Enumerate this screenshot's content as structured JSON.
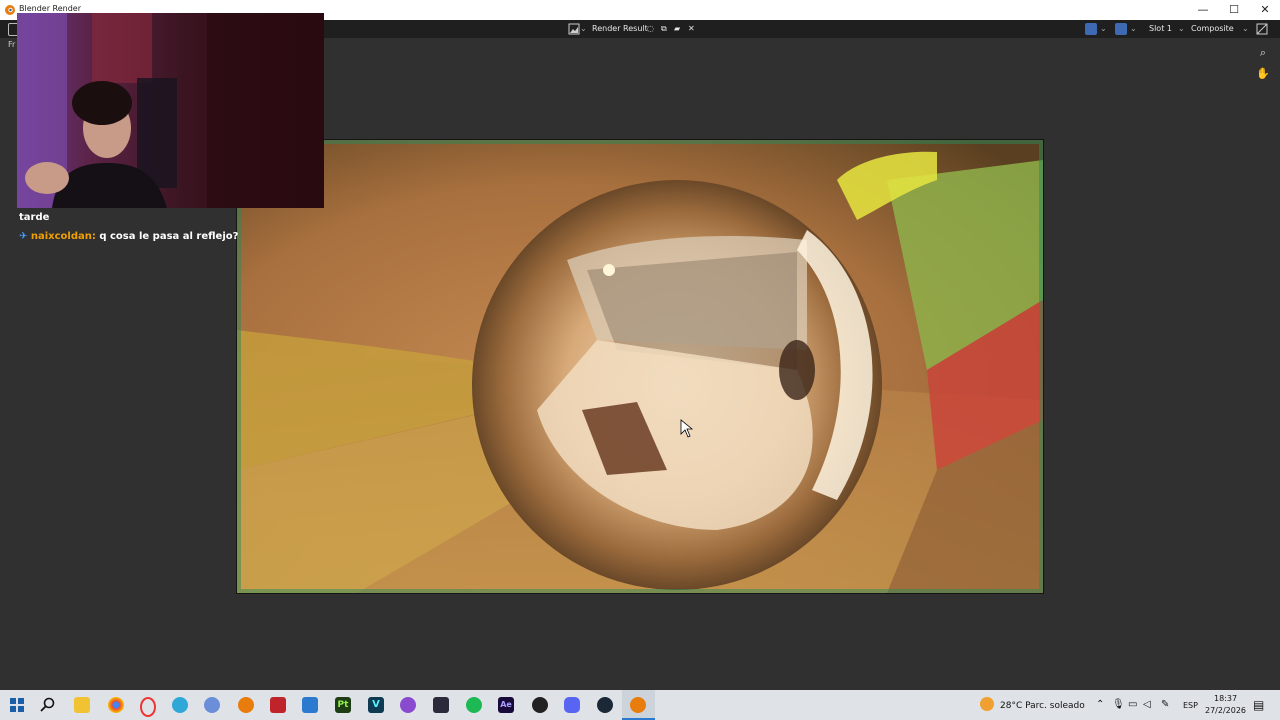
{
  "window": {
    "title": "Blender Render",
    "minimize_glyph": "—",
    "maximize_glyph": "☐",
    "close_glyph": "✕"
  },
  "header": {
    "image_name": "Render Result",
    "slot": "Slot 1",
    "layer": "Composite",
    "frame_stub": "Fr"
  },
  "chat": {
    "messages": [
      {
        "user": "",
        "text": "tarde"
      },
      {
        "user": "naixcoldan:",
        "text": "q cosa le pasa al reflejo?"
      }
    ]
  },
  "taskbar": {
    "weather": "28°C  Parc. soleado",
    "language": "ESP",
    "time": "18:37",
    "date": "27/2/2026",
    "icons": [
      "start-icon",
      "search-icon",
      "file-explorer-icon",
      "chrome-icon",
      "opera-icon",
      "edge-icon",
      "app-spiral-icon",
      "blender-icon",
      "video-editor-icon",
      "photos-icon",
      "pt-app-icon",
      "v-app-icon",
      "app-purple-icon",
      "app-dark-icon",
      "spotify-icon",
      "after-effects-icon",
      "app-circle-icon",
      "discord-icon",
      "steam-icon",
      "blender-active-icon"
    ]
  },
  "colors": {
    "blender_bg": "#303030",
    "header_bg": "#1f1f1f",
    "taskbar_bg": "#dfe3e8",
    "chat_user": "#f0a000"
  }
}
